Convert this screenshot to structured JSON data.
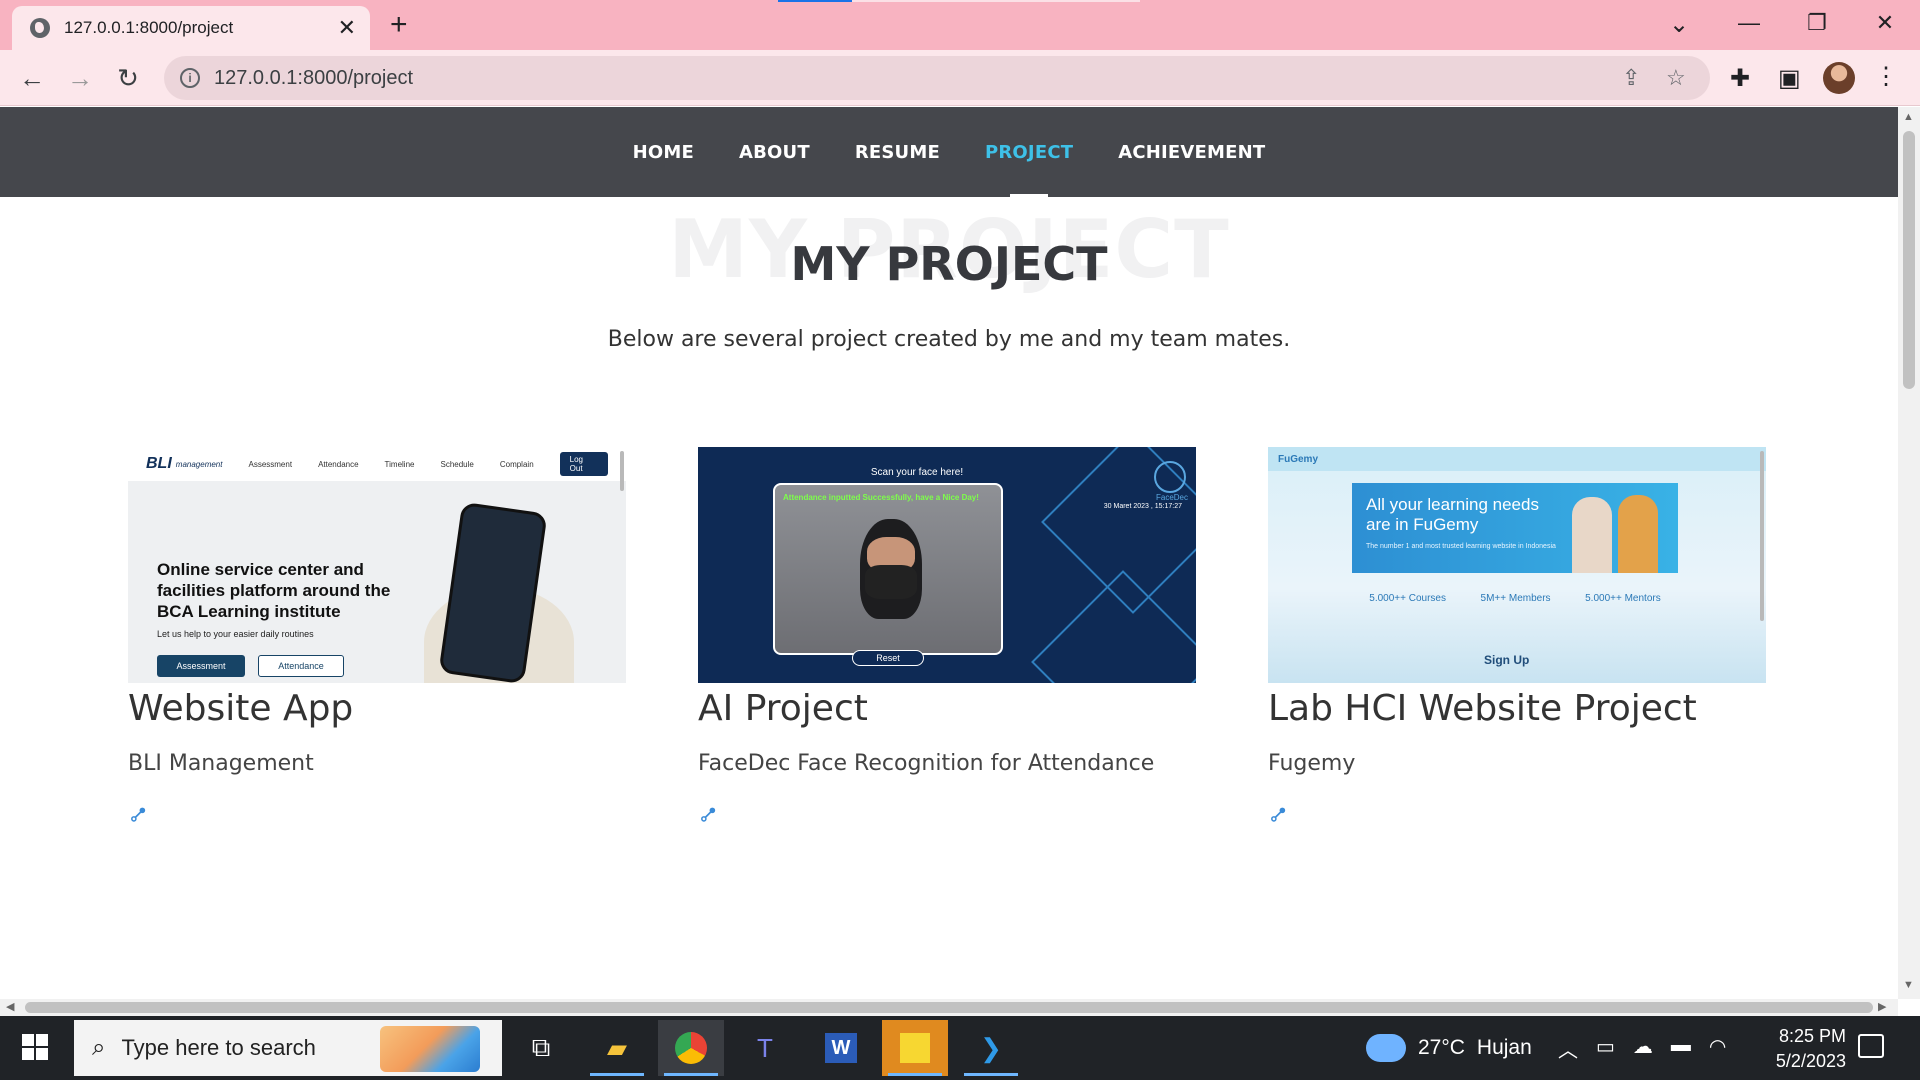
{
  "browser": {
    "tab_title": "127.0.0.1:8000/project",
    "tab_close": "✕",
    "new_tab": "+",
    "url": "127.0.0.1:8000/project",
    "window_controls": [
      "⌄",
      "—",
      "❐",
      "✕"
    ]
  },
  "site": {
    "nav": [
      {
        "label": "HOME",
        "active": false
      },
      {
        "label": "ABOUT",
        "active": false
      },
      {
        "label": "RESUME",
        "active": false
      },
      {
        "label": "PROJECT",
        "active": true
      },
      {
        "label": "ACHIEVEMENT",
        "active": false
      }
    ],
    "section_bg_title": "MY PROJECT",
    "section_title": "MY PROJECT",
    "section_subtitle": "Below are several project created by me and my team mates.",
    "projects": [
      {
        "title": "Website App",
        "description": "BLI Management",
        "thumb": {
          "logo": "BLI",
          "logo_sub": "management",
          "nav": [
            "Assessment",
            "Attendance",
            "Timeline",
            "Schedule",
            "Complain"
          ],
          "logout": "Log Out",
          "hero": "Online service center and facilities platform around the BCA Learning institute",
          "small": "Let us help to your easier daily routines",
          "btn1": "Assessment",
          "btn2": "Attendance"
        }
      },
      {
        "title": "AI Project",
        "description": "FaceDec Face Recognition for Attendance",
        "thumb": {
          "caption": "Scan your face here!",
          "status": "Attendance inputted Successfully, have a Nice Day!",
          "reset": "Reset",
          "brand": "FaceDec",
          "date": "30 Maret 2023 , 15:17:27"
        }
      },
      {
        "title": "Lab HCI Website Project",
        "description": "Fugemy",
        "thumb": {
          "logo": "FuGemy",
          "banner": "All your learning needs are in FuGemy",
          "banner_sub": "The number 1 and most trusted learning website in Indonesia",
          "stats": [
            "5.000++ Courses",
            "5M++ Members",
            "5.000++ Mentors"
          ],
          "signup": "Sign Up"
        }
      }
    ]
  },
  "taskbar": {
    "search_placeholder": "Type here to search",
    "weather_temp": "27°C",
    "weather_text": "Hujan",
    "time": "8:25 PM",
    "date": "5/2/2023"
  }
}
